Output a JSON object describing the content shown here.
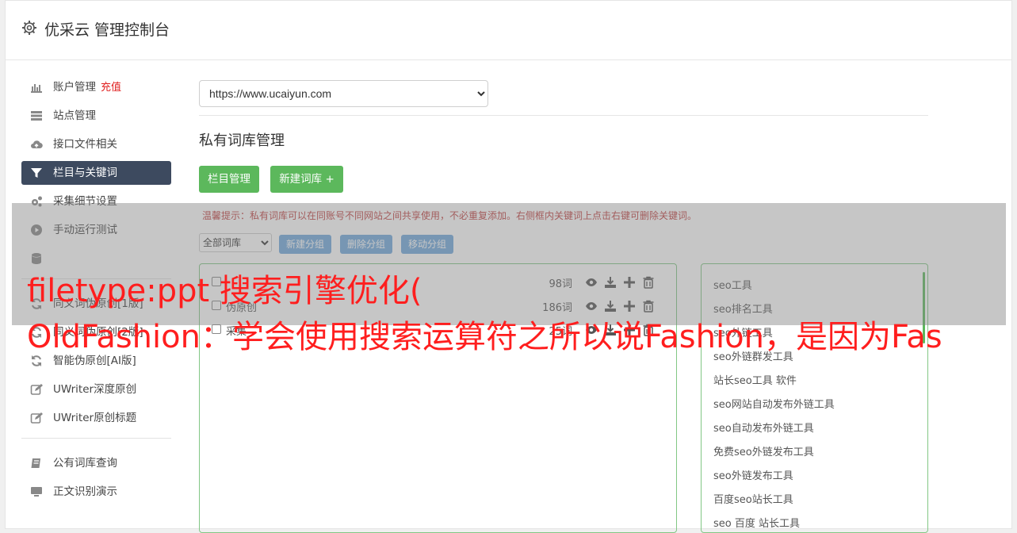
{
  "header": {
    "title": "优采云 管理控制台",
    "icon": "gear-icon"
  },
  "sidebar": {
    "items": [
      {
        "label": "账户管理",
        "extra": "充值",
        "icon": "bar-chart-icon"
      },
      {
        "label": "站点管理",
        "icon": "server-icon"
      },
      {
        "label": "接口文件相关",
        "icon": "cloud-upload-icon"
      },
      {
        "label": "栏目与关键词",
        "icon": "filter-icon",
        "active": true
      },
      {
        "label": "采集细节设置",
        "icon": "cogs-icon"
      },
      {
        "label": "手动运行测试",
        "icon": "play-circle-icon"
      },
      {
        "label": "文章暂存库",
        "icon": "database-icon"
      },
      {
        "label": "同义词伪原创[1版]",
        "icon": "refresh-icon"
      },
      {
        "label": "同义词伪原创[2版]",
        "icon": "refresh-icon"
      },
      {
        "label": "智能伪原创[AI版]",
        "icon": "refresh-icon"
      },
      {
        "label": "UWriter深度原创",
        "icon": "edit-icon"
      },
      {
        "label": "UWriter原创标题",
        "icon": "edit-icon"
      },
      {
        "label": "公有词库查询",
        "icon": "book-icon"
      },
      {
        "label": "正文识别演示",
        "icon": "monitor-icon"
      }
    ]
  },
  "main": {
    "site_select": {
      "value": "https://www.ucaiyun.com"
    },
    "title": "私有词库管理",
    "buttons": {
      "columns": "栏目管理",
      "new_library": "新建词库 +"
    },
    "tip": "温馨提示：私有词库可以在同账号不同网站之间共享使用，不必重复添加。右侧框内关键词上点击右键可删除关键词。",
    "group_select": {
      "value": "全部词库"
    },
    "group_buttons": {
      "new": "新建分组",
      "delete": "删除分组",
      "move": "移动分组"
    },
    "libraries": [
      {
        "name": "",
        "count": "98词"
      },
      {
        "name": "伪原创",
        "count": "186词"
      },
      {
        "name": "采集",
        "count": "25词"
      }
    ],
    "keywords": [
      "seo工具",
      "seo排名工具",
      "seo外链工具",
      "seo外链群发工具",
      "站长seo工具 软件",
      "seo网站自动发布外链工具",
      "seo自动发布外链工具",
      "免费seo外链发布工具",
      "seo外链发布工具",
      "百度seo站长工具",
      "seo 百度 站长工具"
    ]
  },
  "watermark": {
    "line1": "filetype:ppt 搜索引擎优化(",
    "line2": "OldFashion：学会使用搜索运算符之所以说Fashion，是因为Fas"
  },
  "colors": {
    "accent_green": "#5cb85c",
    "nav_active": "#3d4a5f",
    "watermark": "#ff1e1e"
  }
}
